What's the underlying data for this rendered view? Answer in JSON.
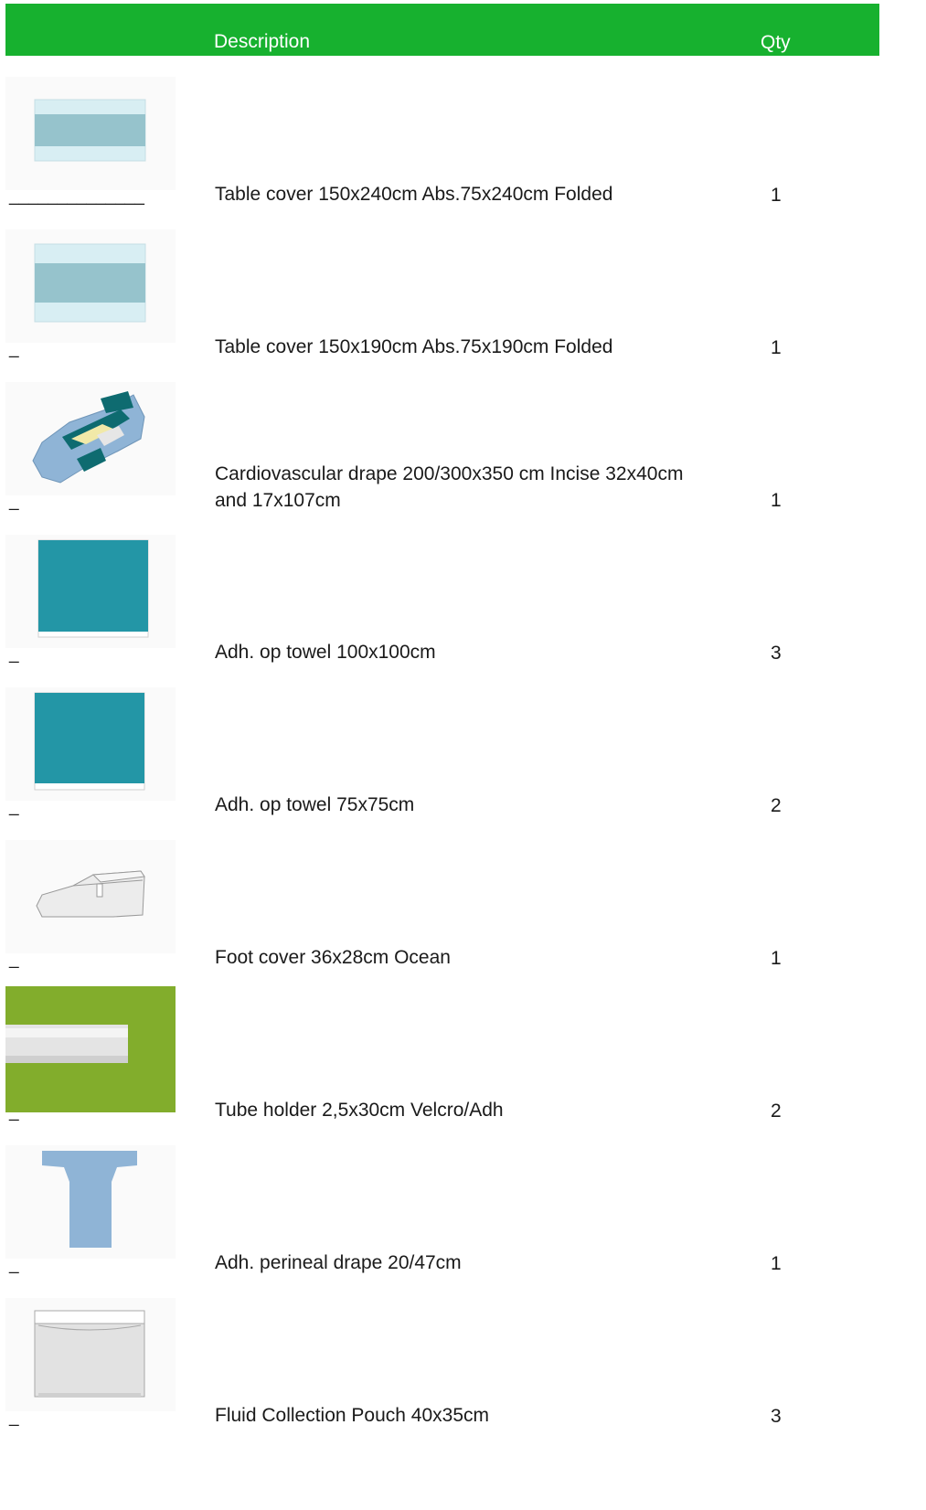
{
  "header": {
    "description_label": "Description",
    "qty_label": "Qty"
  },
  "items": [
    {
      "marker": "______________",
      "description": "Table cover 150x240cm Abs.75x240cm Folded",
      "qty": "1",
      "icon": "table-cover-icon"
    },
    {
      "marker": "_",
      "description": "Table cover 150x190cm Abs.75x190cm Folded",
      "qty": "1",
      "icon": "table-cover-icon"
    },
    {
      "marker": "_",
      "description": "Cardiovascular drape 200/300x350 cm Incise 32x40cm and 17x107cm",
      "qty": "1",
      "icon": "drape-icon"
    },
    {
      "marker": "_",
      "description": "Adh. op towel 100x100cm",
      "qty": "3",
      "icon": "towel-icon"
    },
    {
      "marker": "_",
      "description": "Adh. op towel 75x75cm",
      "qty": "2",
      "icon": "towel-icon"
    },
    {
      "marker": "_",
      "description": "Foot cover 36x28cm Ocean",
      "qty": "1",
      "icon": "foot-cover-icon"
    },
    {
      "marker": "_",
      "description": "Tube holder 2,5x30cm Velcro/Adh",
      "qty": "2",
      "icon": "tube-holder-icon"
    },
    {
      "marker": "_",
      "description": "Adh. perineal drape 20/47cm",
      "qty": "1",
      "icon": "perineal-drape-icon"
    },
    {
      "marker": "_",
      "description": "Fluid Collection Pouch 40x35cm",
      "qty": "3",
      "icon": "pouch-icon"
    }
  ],
  "colors": {
    "header": "#17b12f",
    "table_cover_band": "#96c3cc",
    "table_cover_light": "#d8eef3",
    "towel": "#2396a6",
    "tube_bg": "#82ad2c",
    "perineal": "#8fb4d6"
  }
}
